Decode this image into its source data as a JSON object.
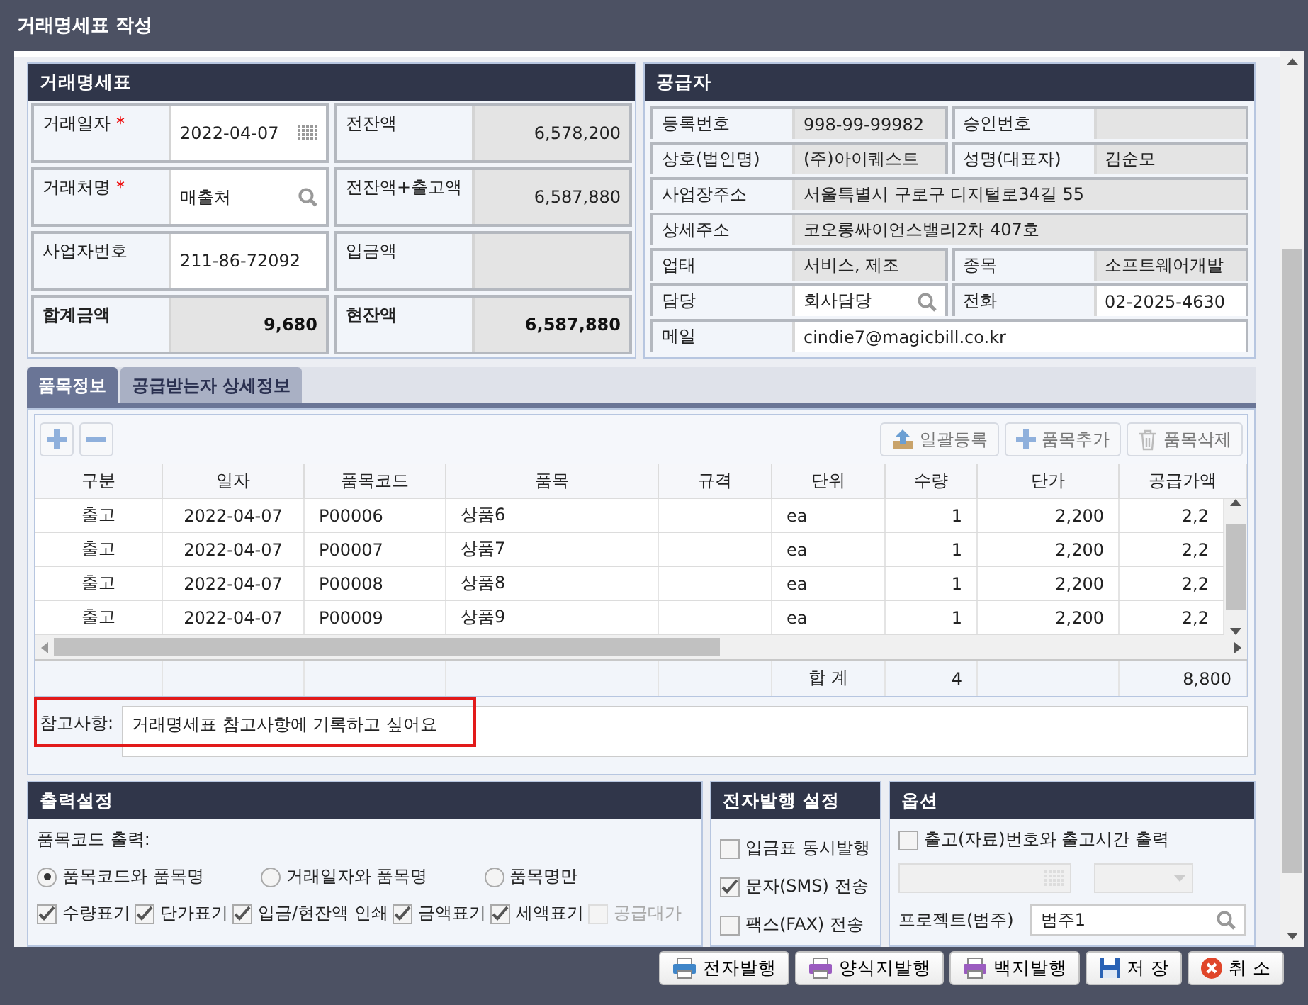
{
  "window": {
    "title": "거래명세표 작성"
  },
  "invoice": {
    "title": "거래명세표",
    "cells": [
      {
        "label": "거래일자",
        "required_mark": "*",
        "kind": "date",
        "value": "2022-04-07",
        "bold": false
      },
      {
        "label": "전잔액",
        "kind": "readonly",
        "value": "6,578,200",
        "bold": false
      },
      {
        "label": "거래처명",
        "required_mark": "*",
        "kind": "search",
        "value": "매출처",
        "bold": false
      },
      {
        "label": "전잔액+출고액",
        "kind": "readonly",
        "value": "6,587,880",
        "bold": false
      },
      {
        "label": "사업자번호",
        "kind": "input",
        "value": "211-86-72092",
        "bold": false
      },
      {
        "label": "입금액",
        "kind": "readonly",
        "bold": false
      },
      {
        "label": "합계금액",
        "kind": "readonly",
        "value": "9,680",
        "bold": true
      },
      {
        "label": "현잔액",
        "kind": "readonly",
        "value": "6,587,880",
        "bold": true
      }
    ]
  },
  "supplier": {
    "title": "공급자",
    "rows": [
      [
        {
          "label": "등록번호",
          "kind": "readonly",
          "value": "998-99-99982"
        },
        {
          "label": "승인번호",
          "kind": "readonly"
        }
      ],
      [
        {
          "label": "상호(법인명)",
          "kind": "readonly",
          "value": "(주)아이퀘스트"
        },
        {
          "label": "성명(대표자)",
          "kind": "readonly",
          "value": "김순모"
        }
      ],
      [
        {
          "label": "사업장주소",
          "kind": "readonly",
          "value": "서울특별시 구로구 디지털로34길 55"
        }
      ],
      [
        {
          "label": "상세주소",
          "kind": "readonly",
          "value": "코오롱싸이언스밸리2차 407호"
        }
      ],
      [
        {
          "label": "업태",
          "kind": "readonly",
          "value": "서비스, 제조"
        },
        {
          "label": "종목",
          "kind": "readonly",
          "value": "소프트웨어개발"
        }
      ],
      [
        {
          "label": "담당",
          "kind": "search",
          "value": "회사담당"
        },
        {
          "label": "전화",
          "kind": "input",
          "value": "02-2025-4630"
        }
      ],
      [
        {
          "label": "메일",
          "kind": "input",
          "value": "cindie7@magicbill.co.kr"
        }
      ]
    ]
  },
  "tabs": [
    {
      "label": "품목정보",
      "selected": true
    },
    {
      "label": "공급받는자 상세정보",
      "selected": false
    }
  ],
  "grid": {
    "toolbar": [
      {
        "label": "일괄등록",
        "kind": "upload"
      },
      {
        "label": "품목추가",
        "kind": "add"
      },
      {
        "label": "품목삭제",
        "kind": "delete"
      }
    ],
    "columns": [
      "구분",
      "일자",
      "품목코드",
      "품목",
      "규격",
      "단위",
      "수량",
      "단가",
      "공급가액"
    ],
    "rows": [
      [
        "출고",
        "2022-04-07",
        "P00006",
        "상품6",
        "",
        "ea",
        "1",
        "2,200",
        "2,2"
      ],
      [
        "출고",
        "2022-04-07",
        "P00007",
        "상품7",
        "",
        "ea",
        "1",
        "2,200",
        "2,2"
      ],
      [
        "출고",
        "2022-04-07",
        "P00008",
        "상품8",
        "",
        "ea",
        "1",
        "2,200",
        "2,2"
      ],
      [
        "출고",
        "2022-04-07",
        "P00009",
        "상품9",
        "",
        "ea",
        "1",
        "2,200",
        "2,2"
      ]
    ],
    "footer": {
      "label": "합 계",
      "quantity": "4",
      "amount": "8,800"
    },
    "note": {
      "label": "참고사항:",
      "value": "거래명세표 참고사항에 기록하고 싶어요",
      "highlighted": true
    }
  },
  "print_settings": {
    "title": "출력설정",
    "code_label": "품목코드 출력:",
    "radios": [
      {
        "label": "품목코드와 품목명",
        "selected": true
      },
      {
        "label": "거래일자와 품목명",
        "selected": false
      },
      {
        "label": "품목명만",
        "selected": false
      }
    ],
    "checks": [
      {
        "label": "수량표기",
        "checked": true,
        "disabled": false
      },
      {
        "label": "단가표기",
        "checked": true,
        "disabled": false
      },
      {
        "label": "입금/현잔액 인쇄",
        "checked": true,
        "disabled": false
      },
      {
        "label": "금액표기",
        "checked": true,
        "disabled": false
      },
      {
        "label": "세액표기",
        "checked": true,
        "disabled": false
      },
      {
        "label": "공급대가",
        "checked": false,
        "disabled": true
      }
    ]
  },
  "e_issue": {
    "title": "전자발행 설정",
    "checks": [
      {
        "label": "입금표 동시발행",
        "checked": false
      },
      {
        "label": "문자(SMS) 전송",
        "checked": true
      },
      {
        "label": "팩스(FAX) 전송",
        "checked": false
      }
    ]
  },
  "options": {
    "title": "옵션",
    "checks": [
      {
        "label": "출고(자료)번호와 출고시간 출력",
        "checked": false
      }
    ],
    "project": {
      "label": "프로젝트(범주)",
      "value": "범주1"
    }
  },
  "buttons": [
    {
      "label": "전자발행",
      "kind": "print-blue"
    },
    {
      "label": "양식지발행",
      "kind": "print-purple"
    },
    {
      "label": "백지발행",
      "kind": "print-purple"
    },
    {
      "label": "저 장",
      "kind": "save"
    },
    {
      "label": "취 소",
      "kind": "cancel"
    }
  ]
}
